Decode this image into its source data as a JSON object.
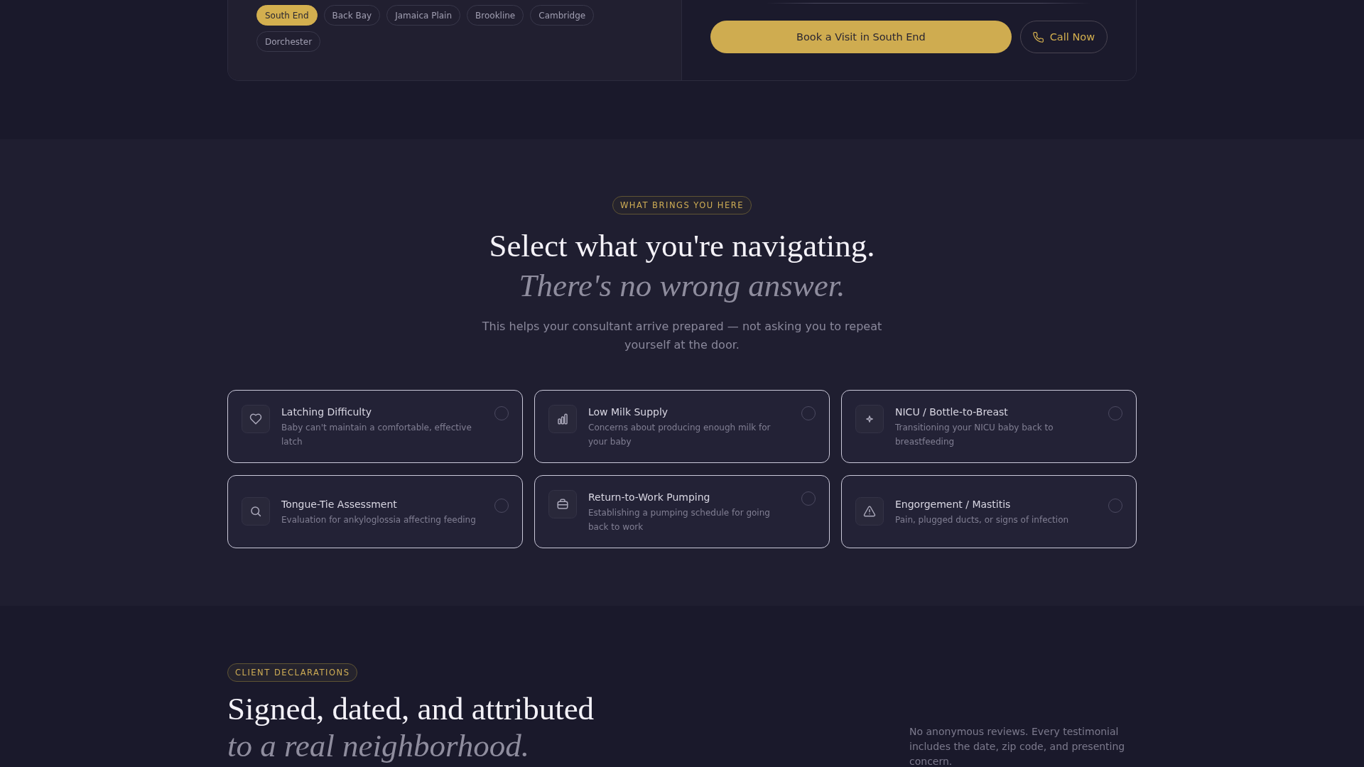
{
  "booking_panel": {
    "neighborhoods": [
      {
        "label": "South End",
        "selected": true
      },
      {
        "label": "Back Bay",
        "selected": false
      },
      {
        "label": "Jamaica Plain",
        "selected": false
      },
      {
        "label": "Brookline",
        "selected": false
      },
      {
        "label": "Cambridge",
        "selected": false
      },
      {
        "label": "Dorchester",
        "selected": false
      }
    ],
    "book_button": "Book a Visit in South End",
    "call_button": "Call Now"
  },
  "concerns_section": {
    "badge": "WHAT BRINGS YOU HERE",
    "heading": "Select what you're navigating.",
    "heading_italic": "There's no wrong answer.",
    "intro": "This helps your consultant arrive prepared — not asking you to repeat yourself at the door.",
    "options": [
      {
        "title": "Latching Difficulty",
        "description": "Baby can't maintain a comfortable, effective latch",
        "selected": false
      },
      {
        "title": "Low Milk Supply",
        "description": "Concerns about producing enough milk for your baby",
        "selected": false
      },
      {
        "title": "NICU / Bottle-to-Breast",
        "description": "Transitioning your NICU baby back to breastfeeding",
        "selected": false
      },
      {
        "title": "Tongue-Tie Assessment",
        "description": "Evaluation for ankyloglossia affecting feeding",
        "selected": false
      },
      {
        "title": "Return-to-Work Pumping",
        "description": "Establishing a pumping schedule for going back to work",
        "selected": false
      },
      {
        "title": "Engorgement / Mastitis",
        "description": "Pain, plugged ducts, or signs of infection",
        "selected": false
      }
    ]
  },
  "testimonials_section": {
    "badge": "CLIENT DECLARATIONS",
    "heading": "Signed, dated, and attributed",
    "heading_italic": "to a real neighborhood.",
    "note": "No anonymous reviews. Every testimonial includes the date, zip code, and presenting concern."
  }
}
